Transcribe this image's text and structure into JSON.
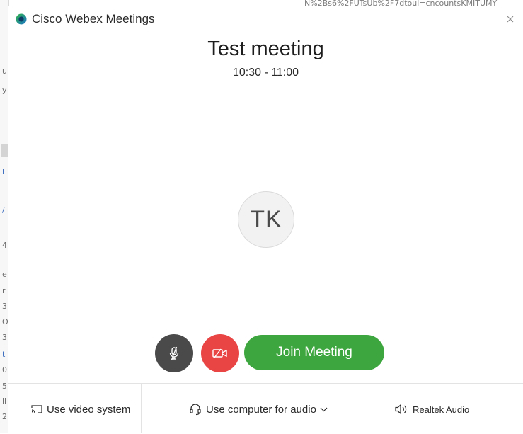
{
  "window": {
    "app_title": "Cisco Webex Meetings"
  },
  "meeting": {
    "title": "Test meeting",
    "time": "10:30 - 11:00",
    "host_initials": "TK"
  },
  "controls": {
    "join_label": "Join Meeting",
    "mute_icon": "microphone-muted-icon",
    "video_icon": "video-off-icon"
  },
  "footer": {
    "video_system_label": "Use video system",
    "audio_label": "Use computer for audio",
    "speaker_label": "Realtek Audio"
  },
  "colors": {
    "join_green": "#3ea63e",
    "video_off_red": "#e94545",
    "mute_gray": "#4a4a4a",
    "webex_blue": "#1a73c9",
    "webex_green": "#31b34a"
  }
}
